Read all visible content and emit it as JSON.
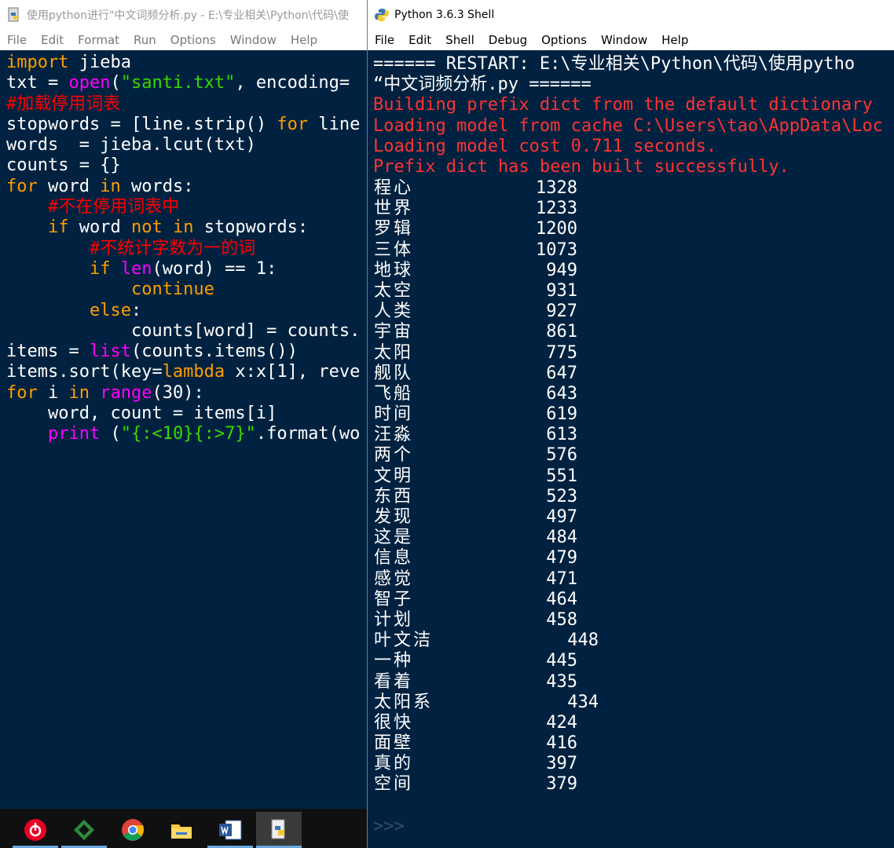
{
  "editor": {
    "title": "使用python进行\"中文词频分析.py - E:\\专业相关\\Python\\代码\\使",
    "menu": [
      "File",
      "Edit",
      "Format",
      "Run",
      "Options",
      "Window",
      "Help"
    ]
  },
  "shell": {
    "title": "Python 3.6.3 Shell",
    "menu": [
      "File",
      "Edit",
      "Shell",
      "Debug",
      "Options",
      "Window",
      "Help"
    ],
    "restart_line1": "====== RESTART: E:\\专业相关\\Python\\代码\\使用pytho",
    "restart_line2": "“中文词频分析.py ======",
    "msg1": "Building prefix dict from the default dictionary",
    "msg2": "Loading model from cache C:\\Users\\tao\\AppData\\Loc",
    "msg3": "Loading model cost 0.711 seconds.",
    "msg4": "Prefix dict has been built successfully.",
    "prompt": ">>>",
    "rows": [
      {
        "word": "程心",
        "count": "1328"
      },
      {
        "word": "世界",
        "count": "1233"
      },
      {
        "word": "罗辑",
        "count": "1200"
      },
      {
        "word": "三体",
        "count": "1073"
      },
      {
        "word": "地球",
        "count": "949"
      },
      {
        "word": "太空",
        "count": "931"
      },
      {
        "word": "人类",
        "count": "927"
      },
      {
        "word": "宇宙",
        "count": "861"
      },
      {
        "word": "太阳",
        "count": "775"
      },
      {
        "word": "舰队",
        "count": "647"
      },
      {
        "word": "飞船",
        "count": "643"
      },
      {
        "word": "时间",
        "count": "619"
      },
      {
        "word": "汪淼",
        "count": "613"
      },
      {
        "word": "两个",
        "count": "576"
      },
      {
        "word": "文明",
        "count": "551"
      },
      {
        "word": "东西",
        "count": "523"
      },
      {
        "word": "发现",
        "count": "497"
      },
      {
        "word": "这是",
        "count": "484"
      },
      {
        "word": "信息",
        "count": "479"
      },
      {
        "word": "感觉",
        "count": "471"
      },
      {
        "word": "智子",
        "count": "464"
      },
      {
        "word": "计划",
        "count": "458"
      },
      {
        "word": "叶文洁",
        "count": "448"
      },
      {
        "word": "一种",
        "count": "445"
      },
      {
        "word": "看着",
        "count": "435"
      },
      {
        "word": "太阳系",
        "count": "434"
      },
      {
        "word": "很快",
        "count": "424"
      },
      {
        "word": "面壁",
        "count": "416"
      },
      {
        "word": "真的",
        "count": "397"
      },
      {
        "word": "空间",
        "count": "379"
      }
    ]
  },
  "taskbar": {
    "icons": [
      "netease-music-icon",
      "dev-tool-icon",
      "chrome-icon",
      "file-explorer-icon",
      "word-icon",
      "python-idle-icon"
    ]
  }
}
